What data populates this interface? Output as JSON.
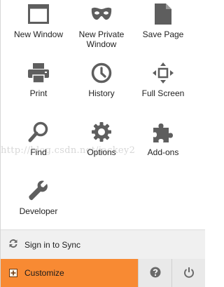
{
  "menu": {
    "items": [
      {
        "label": "New Window",
        "icon": "new-window-icon"
      },
      {
        "label": "New Private\nWindow",
        "icon": "mask-icon"
      },
      {
        "label": "Save Page",
        "icon": "page-icon"
      },
      {
        "label": "Print",
        "icon": "printer-icon"
      },
      {
        "label": "History",
        "icon": "clock-icon"
      },
      {
        "label": "Full Screen",
        "icon": "fullscreen-icon"
      },
      {
        "label": "Find",
        "icon": "magnifier-icon"
      },
      {
        "label": "Options",
        "icon": "gear-icon"
      },
      {
        "label": "Add-ons",
        "icon": "puzzle-icon"
      },
      {
        "label": "Developer",
        "icon": "wrench-icon"
      }
    ]
  },
  "watermark": "http://blog.csdn.net/jackey2",
  "sync": {
    "label": "Sign in to Sync",
    "icon": "sync-icon"
  },
  "footer": {
    "customize_label": "Customize",
    "customize_icon": "plus-icon",
    "help_icon": "help-icon",
    "quit_icon": "power-icon"
  },
  "colors": {
    "accent": "#f88a33",
    "icon": "#5e5e5e"
  }
}
